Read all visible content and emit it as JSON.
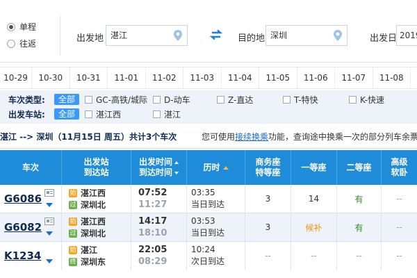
{
  "search": {
    "trip_one_way": "单程",
    "trip_round": "往返",
    "from_label": "出发地",
    "from_value": "湛江",
    "to_label": "目的地",
    "to_value": "深圳",
    "date_label": "出发日",
    "date_value": "2019"
  },
  "dates": [
    "10-29",
    "10-30",
    "10-31",
    "11-01",
    "11-02",
    "11-03",
    "11-04",
    "11-05",
    "11-06",
    "11-07",
    "11-08"
  ],
  "filters": {
    "type_label": "车次类型:",
    "all": "全部",
    "types": [
      "GC-高铁/城际",
      "D-动车",
      "Z-直达",
      "T-特快",
      "K-快速"
    ],
    "station_label": "出发车站:",
    "stations": [
      "湛江西",
      "湛江"
    ]
  },
  "summary": {
    "route": "湛江 --> 深圳（11月15日  周五）共计3个车次",
    "hint_pre": "您可使用",
    "hint_link": "接续换乘",
    "hint_post": "功能，查询途中换乘一次的部分列车余票"
  },
  "table": {
    "col_train": "车次",
    "col_station_1": "出发站",
    "col_station_2": "到达站",
    "col_time_1": "出发时间",
    "col_time_2": "到达时间",
    "col_duration": "历时",
    "col_business_1": "商务座",
    "col_business_2": "特等座",
    "col_first": "一等座",
    "col_second": "二等座",
    "col_soft_1": "高级",
    "col_soft_2": "软卧",
    "rows": [
      {
        "train": "G6086",
        "from": "湛江西",
        "to": "深圳北",
        "from_tag": "始",
        "to_tag": "过",
        "depart": "07:52",
        "arrive": "11:27",
        "duration": "03:35",
        "arrive_day": "当日到达",
        "business": "3",
        "first": "14",
        "second": "有",
        "soft": "--"
      },
      {
        "train": "G6082",
        "from": "湛江西",
        "to": "深圳北",
        "from_tag": "始",
        "to_tag": "过",
        "depart": "14:17",
        "arrive": "18:10",
        "duration": "03:53",
        "arrive_day": "当日到达",
        "business": "3",
        "first": "候补",
        "second": "有",
        "soft": "--"
      },
      {
        "train": "K1234",
        "from": "湛江",
        "to": "深圳东",
        "from_tag": "始",
        "to_tag": "终",
        "depart": "22:05",
        "arrive": "08:29",
        "duration": "10:24",
        "arrive_day": "次日到达",
        "business": "--",
        "first": "--",
        "second": "--",
        "soft": "--"
      }
    ]
  },
  "colors": {
    "header_blue": "#1e8cd8",
    "accent_blue": "#3b99fc",
    "available_green": "#2c8a2c",
    "waitlist_orange": "#e89514",
    "depart_tag": "#f5a623",
    "stop_tag": "#6ab04c"
  }
}
